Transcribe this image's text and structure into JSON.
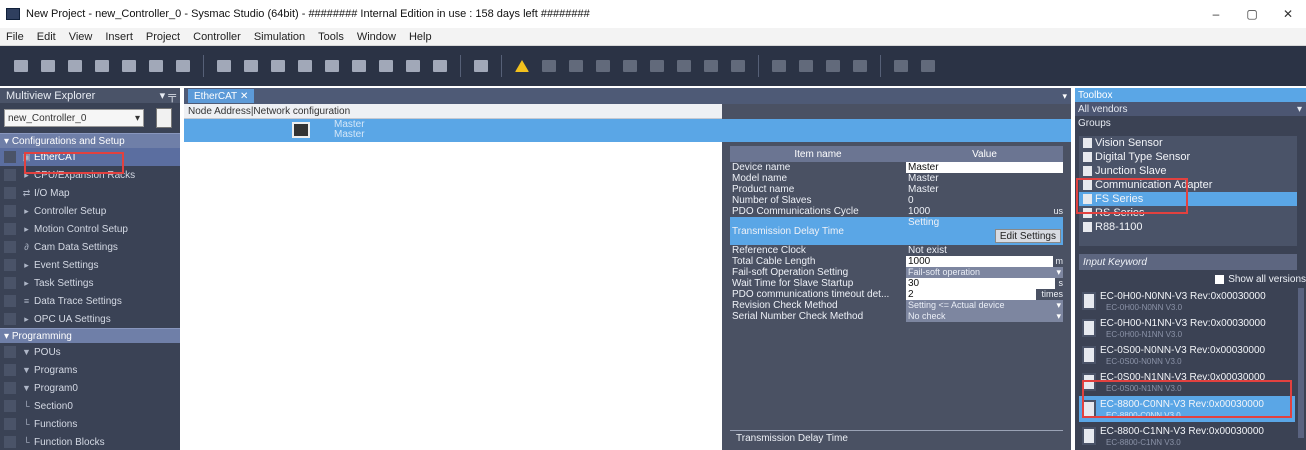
{
  "titlebar": {
    "title": "New Project - new_Controller_0 - Sysmac Studio (64bit) - ######## Internal Edition in use : 158 days left ########",
    "minimize": "–",
    "maximize": "▢",
    "close": "✕"
  },
  "menu": [
    "File",
    "Edit",
    "View",
    "Insert",
    "Project",
    "Controller",
    "Simulation",
    "Tools",
    "Window",
    "Help"
  ],
  "explorer": {
    "title": "Multiview Explorer",
    "pin": "▾ ╤",
    "controller": "new_Controller_0",
    "sections": {
      "config": "Configurations and Setup",
      "programming": "Programming"
    },
    "config_items": [
      {
        "icon": "▣",
        "label": "EtherCAT"
      },
      {
        "icon": "▸",
        "label": "CPU/Expansion Racks"
      },
      {
        "icon": "⇄",
        "label": "I/O Map"
      },
      {
        "icon": "▸",
        "label": "Controller Setup"
      },
      {
        "icon": "▸",
        "label": "Motion Control Setup"
      },
      {
        "icon": "∂",
        "label": "Cam Data Settings"
      },
      {
        "icon": "▸",
        "label": "Event Settings"
      },
      {
        "icon": "▸",
        "label": "Task Settings"
      },
      {
        "icon": "≡",
        "label": "Data Trace Settings"
      },
      {
        "icon": "▸",
        "label": "OPC UA Settings"
      }
    ],
    "program_items": [
      {
        "icon": "▼",
        "label": "POUs"
      },
      {
        "icon": "▼",
        "label": "Programs"
      },
      {
        "icon": "▼",
        "label": "Program0"
      },
      {
        "icon": "└",
        "label": "Section0"
      },
      {
        "icon": "└",
        "label": "Functions"
      },
      {
        "icon": "└",
        "label": "Function Blocks"
      }
    ]
  },
  "center": {
    "tab": "EtherCAT",
    "tab_close": "✕",
    "tab_menu": "▾",
    "net_header": "Node Address|Network configuration",
    "master_label_1": "Master",
    "master_label_2": "Master"
  },
  "props": {
    "col_item": "Item name",
    "col_value": "Value",
    "rows": [
      {
        "k": "Device name",
        "v": "Master",
        "type": "box"
      },
      {
        "k": "Model name",
        "v": "Master",
        "type": "text"
      },
      {
        "k": "Product name",
        "v": "Master",
        "type": "text"
      },
      {
        "k": "Number of Slaves",
        "v": "0",
        "type": "text"
      },
      {
        "k": "PDO Communications Cycle",
        "v": "1000",
        "type": "text",
        "unit": "us"
      }
    ],
    "tdt_label": "Transmission Delay Time",
    "tdt_value": "Setting",
    "edit_button": "Edit Settings",
    "rows2": [
      {
        "k": "Reference Clock",
        "v": "Not exist",
        "type": "text"
      },
      {
        "k": "Total Cable Length",
        "v": "1000",
        "type": "box",
        "unit": "m"
      },
      {
        "k": "Fail-soft Operation Setting",
        "v": "Fail-soft operation",
        "type": "dd"
      },
      {
        "k": "Wait Time for Slave Startup",
        "v": "30",
        "type": "box",
        "unit": "s"
      },
      {
        "k": "PDO communications timeout det...",
        "v": "2",
        "type": "box",
        "unit": "times"
      },
      {
        "k": "Revision Check Method",
        "v": "Setting <= Actual device",
        "type": "dd"
      },
      {
        "k": "Serial Number Check Method",
        "v": "No check",
        "type": "dd"
      }
    ],
    "desc_title": "Transmission Delay Time"
  },
  "toolbox": {
    "title": "Toolbox",
    "vendor": "All vendors",
    "groups_label": "Groups",
    "groups": [
      {
        "label": "Vision Sensor",
        "selected": false
      },
      {
        "label": "Digital Type Sensor",
        "selected": false
      },
      {
        "label": "Junction Slave",
        "selected": false
      },
      {
        "label": "Communication Adapter",
        "selected": false
      },
      {
        "label": "FS Series",
        "selected": true
      },
      {
        "label": "RS Series",
        "selected": false
      },
      {
        "label": "R88-1100",
        "selected": false
      }
    ],
    "keyword_label": "Input Keyword",
    "show_all": "Show all versions",
    "devices": [
      {
        "name": "EC-0H00-N0NN-V3 Rev:0x00030000",
        "sub": "EC-0H00-N0NN V3.0",
        "selected": false
      },
      {
        "name": "EC-0H00-N1NN-V3 Rev:0x00030000",
        "sub": "EC-0H00-N1NN V3.0",
        "selected": false
      },
      {
        "name": "EC-0S00-N0NN-V3 Rev:0x00030000",
        "sub": "EC-0S00-N0NN V3.0",
        "selected": false
      },
      {
        "name": "EC-0S00-N1NN-V3 Rev:0x00030000",
        "sub": "EC-0S00-N1NN V3.0",
        "selected": false
      },
      {
        "name": "EC-8800-C0NN-V3 Rev:0x00030000",
        "sub": "EC-8800-C0NN V3.0",
        "selected": true
      },
      {
        "name": "EC-8800-C1NN-V3 Rev:0x00030000",
        "sub": "EC-8800-C1NN V3.0",
        "selected": false
      }
    ]
  },
  "colors": {
    "accent": "#5aa6e6",
    "panel": "#3a4255",
    "highlight_red": "#e2413f"
  }
}
